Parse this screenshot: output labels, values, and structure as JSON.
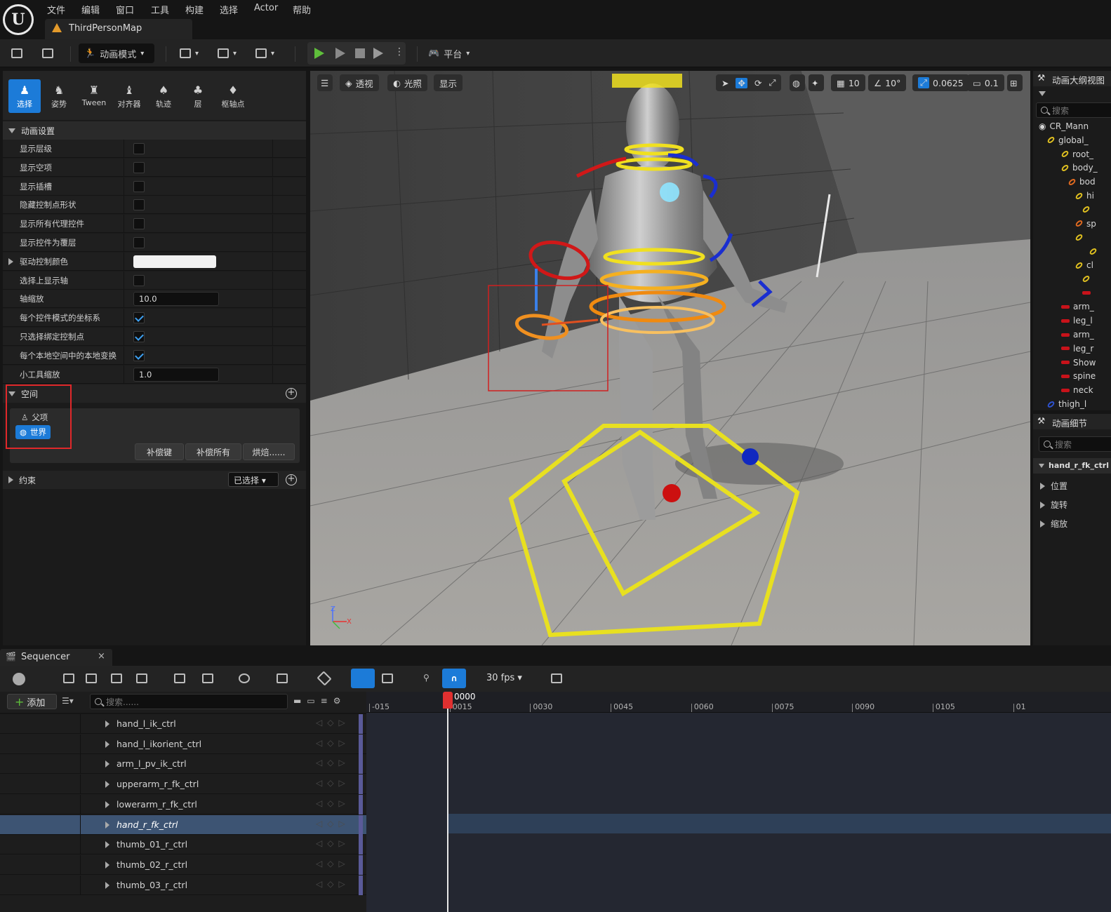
{
  "menu": [
    "文件",
    "编辑",
    "窗口",
    "工具",
    "构建",
    "选择",
    "Actor",
    "帮助"
  ],
  "map_tab": "ThirdPersonMap",
  "toolbar": {
    "anim_mode": "动画模式",
    "platform": "平台"
  },
  "modes": [
    "选择",
    "姿势",
    "Tween",
    "对齐器",
    "轨迹",
    "层",
    "枢轴点"
  ],
  "anim_settings": {
    "header": "动画设置",
    "rows": [
      {
        "label": "显示层级",
        "type": "checkbox",
        "checked": false
      },
      {
        "label": "显示空项",
        "type": "checkbox",
        "checked": false
      },
      {
        "label": "显示插槽",
        "type": "checkbox",
        "checked": false
      },
      {
        "label": "隐藏控制点形状",
        "type": "checkbox",
        "checked": false
      },
      {
        "label": "显示所有代理控件",
        "type": "checkbox",
        "checked": false
      },
      {
        "label": "显示控件为覆层",
        "type": "checkbox",
        "checked": false
      },
      {
        "label": "驱动控制颜色",
        "type": "color",
        "value": "#f2f2f2"
      },
      {
        "label": "选择上显示轴",
        "type": "checkbox",
        "checked": false
      },
      {
        "label": "轴缩放",
        "type": "number",
        "value": "10.0"
      },
      {
        "label": "每个控件模式的坐标系",
        "type": "checkbox",
        "checked": true
      },
      {
        "label": "只选择绑定控制点",
        "type": "checkbox",
        "checked": true
      },
      {
        "label": "每个本地空间中的本地变换",
        "type": "checkbox",
        "checked": true
      },
      {
        "label": "小工具缩放",
        "type": "number",
        "value": "1.0"
      }
    ]
  },
  "space": {
    "header": "空间",
    "parent": "父项",
    "world": "世界",
    "buttons": [
      "补偿键",
      "补偿所有",
      "烘焙......"
    ]
  },
  "constraint": {
    "header": "约束",
    "dropdown": "已选择"
  },
  "viewport": {
    "perspective": "透视",
    "lighting": "光照",
    "show": "显示",
    "grid": "10",
    "angle": "10°",
    "scale": "0.0625",
    "camera": "0.1"
  },
  "outliner": {
    "title": "动画大纲视图",
    "search_placeholder": "搜索",
    "items": [
      {
        "label": "CR_Mann",
        "icon": "eye"
      },
      {
        "label": "global_",
        "icon": "ring"
      },
      {
        "label": "root_",
        "icon": "ring"
      },
      {
        "label": "body_",
        "icon": "ring"
      },
      {
        "label": "bod",
        "icon": "ring-o"
      },
      {
        "label": "hi",
        "icon": "ring"
      },
      {
        "label": "",
        "icon": "ring"
      },
      {
        "label": "sp",
        "icon": "ring-o"
      },
      {
        "label": "",
        "icon": "ring"
      },
      {
        "label": "",
        "icon": "ring"
      },
      {
        "label": "cl",
        "icon": "ring"
      },
      {
        "label": "",
        "icon": "ring"
      },
      {
        "label": "",
        "icon": "bar"
      },
      {
        "label": "arm_",
        "icon": "bar"
      },
      {
        "label": "leg_l",
        "icon": "bar"
      },
      {
        "label": "arm_",
        "icon": "bar"
      },
      {
        "label": "leg_r",
        "icon": "bar"
      },
      {
        "label": "Show",
        "icon": "bar"
      },
      {
        "label": "spine",
        "icon": "bar"
      },
      {
        "label": "neck",
        "icon": "bar"
      },
      {
        "label": "thigh_l",
        "icon": "ring-b"
      }
    ]
  },
  "details": {
    "title": "动画细节",
    "search_placeholder": "搜索",
    "selected": "hand_r_fk_ctrl",
    "props": [
      "位置",
      "旋转",
      "缩放"
    ]
  },
  "sequencer": {
    "tab": "Sequencer",
    "fps": "30 fps",
    "add": "添加",
    "search_placeholder": "搜索......",
    "current_frame": "0000",
    "ticks": [
      "-015",
      "0015",
      "0030",
      "0045",
      "0060",
      "0075",
      "0090",
      "0105",
      "01"
    ],
    "tracks": [
      "hand_l_ik_ctrl",
      "hand_l_ikorient_ctrl",
      "arm_l_pv_ik_ctrl",
      "upperarm_r_fk_ctrl",
      "lowerarm_r_fk_ctrl",
      "hand_r_fk_ctrl",
      "thumb_01_r_ctrl",
      "thumb_02_r_ctrl",
      "thumb_03_r_ctrl"
    ],
    "selected_track": "hand_r_fk_ctrl"
  }
}
